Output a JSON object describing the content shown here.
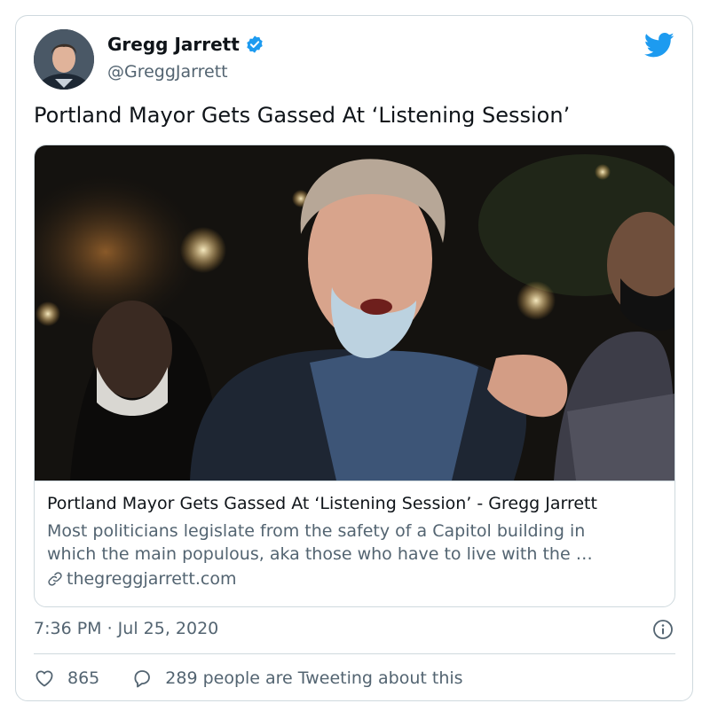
{
  "author": {
    "display_name": "Gregg Jarrett",
    "handle": "@GreggJarrett",
    "verified": true,
    "avatar_icon": "avatar-photo"
  },
  "tweet": {
    "text": "Portland Mayor Gets Gassed At ‘Listening Session’"
  },
  "link_card": {
    "image_icon": "article-photo",
    "title": "Portland Mayor Gets Gassed At ‘Listening Session’ - Gregg Jarrett",
    "description_line1": "Most politicians legislate from the safety of a Capitol building in",
    "description_line2": "which the main populous, aka those who have to live with the …",
    "domain": "thegreggjarrett.com",
    "domain_icon": "link-icon"
  },
  "meta": {
    "timestamp": "7:36 PM · Jul 25, 2020",
    "info_icon": "info-icon"
  },
  "actions": {
    "likes_count": "865",
    "like_icon": "heart-icon",
    "conversation_text": "289 people are Tweeting about this",
    "conversation_icon": "speech-bubble-icon"
  },
  "colors": {
    "twitter_blue": "#1d9bf0",
    "text_primary": "#0f1419",
    "text_secondary": "#536471",
    "border": "#cfd9de"
  }
}
